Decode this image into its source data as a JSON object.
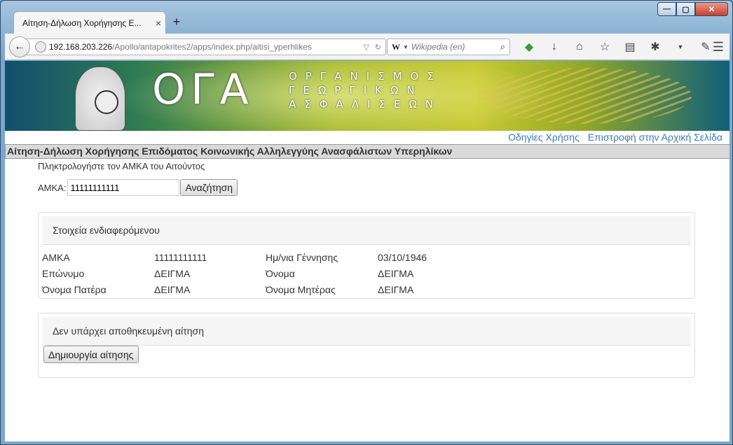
{
  "browser": {
    "tab_title": "Αίτηση-Δήλωση Χορήγησης Ε...",
    "tab_close": "×",
    "new_tab": "+",
    "url_host": "192.168.203.226",
    "url_path": "/Apollo/antapokrites2/apps/index.php/aitisi_yperhlikes",
    "search_engine": "W",
    "search_placeholder": "Wikipedia (en)",
    "window_controls": {
      "minimize": "—",
      "maximize": "▢",
      "close": "✕"
    }
  },
  "banner": {
    "logo_text": "ΟΓΑ",
    "org_line1": "ΟΡΓΑΝΙΣΜΟΣ",
    "org_line2": "ΓΕΩΡΓΙΚΩΝ",
    "org_line3": "ΑΣΦΑΛΙΣΕΩΝ"
  },
  "top_links": {
    "help": "Οδηγίες Χρήσης",
    "home": "Επιστροφή στην Αρχική Σελίδα"
  },
  "page_title": "Αίτηση-Δήλωση Χορήγησης Επιδόματος Κοινωνικής Αλληλεγγύης Ανασφάλιστων Υπερηλίκων",
  "form": {
    "prompt": "Πληκτρολογήστε τον ΑΜΚΑ του Αιτούντος",
    "amka_label": "ΑΜΚΑ:",
    "amka_value": "11111111111",
    "search_button": "Αναζήτηση"
  },
  "person_panel": {
    "heading": "Στοιχεία ενδιαφερόμενου",
    "rows": [
      {
        "l1": "ΑΜΚΑ",
        "v1": "11111111111",
        "l2": "Ημ/νια Γέννησης",
        "v2": "03/10/1946"
      },
      {
        "l1": "Επώνυμο",
        "v1": "ΔΕΙΓΜΑ",
        "l2": "Όνομα",
        "v2": "ΔΕΙΓΜΑ"
      },
      {
        "l1": "Όνομα Πατέρα",
        "v1": "ΔΕΙΓΜΑ",
        "l2": "Όνομα Μητέρας",
        "v2": "ΔΕΙΓΜΑ"
      }
    ]
  },
  "application_panel": {
    "heading": "Δεν υπάρχει αποθηκευμένη αίτηση",
    "create_button": "Δημιουργία αίτησης"
  }
}
